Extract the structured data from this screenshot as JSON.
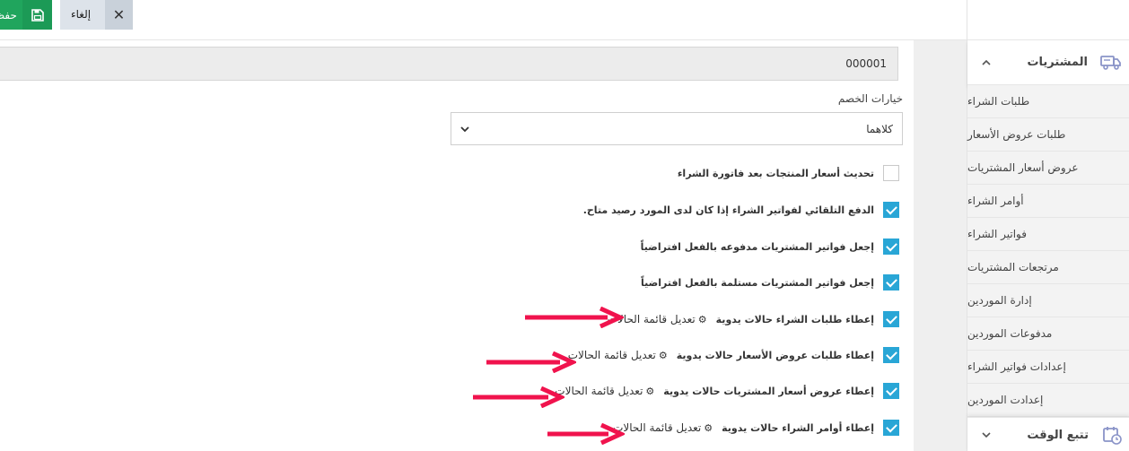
{
  "toolbar": {
    "save_label": "حفظ",
    "cancel_label": "إلغاء"
  },
  "form": {
    "code_value": "000001",
    "discount_label": "خيارات الخصم",
    "discount_select_value": "كلاهما"
  },
  "options": [
    {
      "label": "تحديث أسعار المنتجات بعد فاتورة الشراء",
      "checked": false
    },
    {
      "label": "الدفع التلقائي لفواتير الشراء إذا كان لدى المورد رصيد متاح.",
      "checked": true
    },
    {
      "label": "إجعل فواتير المشتريات مدفوعه بالفعل افتراضياً",
      "checked": true
    },
    {
      "label": "إجعل فواتير المشتريات مستلمة بالفعل افتراضياً",
      "checked": true
    },
    {
      "label": "إعطاء طلبات الشراء حالات يدوية",
      "checked": true,
      "edit": "تعديل قائمة الحالات"
    },
    {
      "label": "إعطاء طلبات عروض الأسعار حالات يدوية",
      "checked": true,
      "edit": "تعديل قائمة الحالات"
    },
    {
      "label": "إعطاء عروض أسعار المشتريات حالات يدوية",
      "checked": true,
      "edit": "تعديل قائمة الحالات"
    },
    {
      "label": "إعطاء أوامر الشراء حالات يدوية",
      "checked": true,
      "edit": "تعديل قائمة الحالات"
    }
  ],
  "sidebar": {
    "purchases_label": "المشتريات",
    "items": [
      "طلبات الشراء",
      "طلبات عروض الأسعار",
      "عروض أسعار المشتريات",
      "أوامر الشراء",
      "فواتير الشراء",
      "مرتجعات المشتريات",
      "إدارة الموردين",
      "مدفوعات الموردين",
      "إعدادات فواتير الشراء",
      "إعدادت الموردين"
    ],
    "timetrack_label": "تتبع الوقت"
  },
  "colors": {
    "save_green": "#20a55d",
    "checkbox_blue": "#29a6d6",
    "annotation_arrow": "#f0134d"
  }
}
